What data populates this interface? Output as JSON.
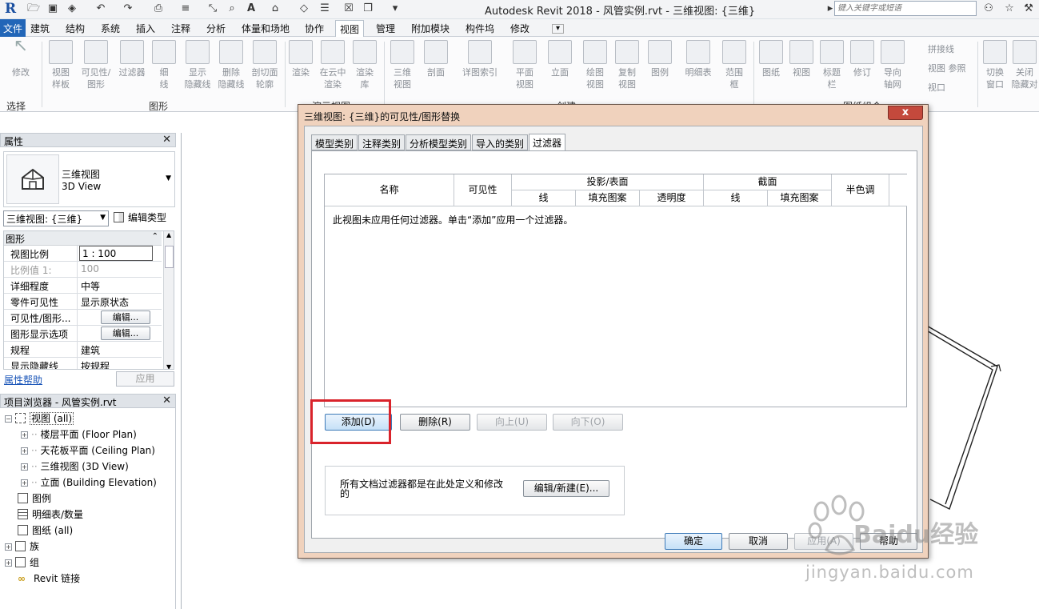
{
  "title_bar": {
    "title": "Autodesk Revit 2018 -    风管实例.rvt - 三维视图: {三维}",
    "search_placeholder": "键入关键字或短语",
    "logo": "R"
  },
  "tabs": [
    "文件",
    "建筑",
    "结构",
    "系统",
    "插入",
    "注释",
    "分析",
    "体量和场地",
    "协作",
    "视图",
    "管理",
    "附加模块",
    "构件坞",
    "修改"
  ],
  "active_tab": "视图",
  "ribbon": {
    "buttons": [
      {
        "label": "修改",
        "sub": ""
      },
      {
        "label": "视图",
        "sub": "样板"
      },
      {
        "label": "可见性/",
        "sub": "图形"
      },
      {
        "label": "过滤器",
        "sub": ""
      },
      {
        "label": "细",
        "sub": "线"
      },
      {
        "label": "显示",
        "sub": "隐藏线"
      },
      {
        "label": "删除",
        "sub": "隐藏线"
      },
      {
        "label": "剖切面",
        "sub": "轮廓"
      },
      {
        "label": "渲染",
        "sub": ""
      },
      {
        "label": "在云中",
        "sub": "渲染"
      },
      {
        "label": "渲染",
        "sub": "库"
      },
      {
        "label": "三维",
        "sub": "视图"
      },
      {
        "label": "剖面",
        "sub": ""
      },
      {
        "label": "详图索引",
        "sub": ""
      },
      {
        "label": "平面",
        "sub": "视图"
      },
      {
        "label": "立面",
        "sub": ""
      },
      {
        "label": "绘图",
        "sub": "视图"
      },
      {
        "label": "复制",
        "sub": "视图"
      },
      {
        "label": "图例",
        "sub": ""
      },
      {
        "label": "明细表",
        "sub": ""
      },
      {
        "label": "范围",
        "sub": "框"
      },
      {
        "label": "图纸",
        "sub": ""
      },
      {
        "label": "视图",
        "sub": ""
      },
      {
        "label": "标题",
        "sub": "栏"
      },
      {
        "label": "修订",
        "sub": ""
      },
      {
        "label": "导向",
        "sub": "轴网"
      },
      {
        "label": "切换",
        "sub": "窗口"
      },
      {
        "label": "关闭",
        "sub": "隐藏对"
      }
    ],
    "small_buttons": [
      "拼接线",
      "视图 参照",
      "视口"
    ],
    "panels": {
      "select": "选择",
      "graphics": "图形",
      "presentation": "演示视图",
      "create": "创建",
      "sheet": "图纸组合"
    }
  },
  "properties": {
    "header": "属性",
    "type_name": "三维视图",
    "type_name_en": "3D View",
    "view_dropdown": "三维视图: {三维}",
    "edit_type": "编辑类型",
    "section": "图形",
    "rows": [
      {
        "key": "视图比例",
        "value": "1 : 100",
        "kind": "input"
      },
      {
        "key": "比例值 1:",
        "value": "100",
        "kind": "disabled"
      },
      {
        "key": "详细程度",
        "value": "中等",
        "kind": "text"
      },
      {
        "key": "零件可见性",
        "value": "显示原状态",
        "kind": "text"
      },
      {
        "key": "可见性/图形...",
        "value": "编辑...",
        "kind": "button"
      },
      {
        "key": "图形显示选项",
        "value": "编辑...",
        "kind": "button"
      },
      {
        "key": "规程",
        "value": "建筑",
        "kind": "text"
      },
      {
        "key": "显示隐藏线",
        "value": "按规程",
        "kind": "text"
      }
    ],
    "help": "属性帮助",
    "apply": "应用"
  },
  "project_browser": {
    "header": "项目浏览器 - 风管实例.rvt",
    "items": [
      {
        "label": "视图 (all)",
        "level": 0,
        "expander": "−"
      },
      {
        "label": "楼层平面 (Floor Plan)",
        "level": 1,
        "expander": "+"
      },
      {
        "label": "天花板平面 (Ceiling Plan)",
        "level": 1,
        "expander": "+"
      },
      {
        "label": "三维视图 (3D View)",
        "level": 1,
        "expander": "+"
      },
      {
        "label": "立面 (Building Elevation)",
        "level": 1,
        "expander": "+"
      },
      {
        "label": "图例",
        "level": 0,
        "expander": ""
      },
      {
        "label": "明细表/数量",
        "level": 0,
        "expander": ""
      },
      {
        "label": "图纸 (all)",
        "level": 0,
        "expander": ""
      },
      {
        "label": "族",
        "level": 0,
        "expander": "+"
      },
      {
        "label": "组",
        "level": 0,
        "expander": "+"
      },
      {
        "label": "Revit 链接",
        "level": 0,
        "expander": ""
      }
    ]
  },
  "dialog": {
    "title": "三维视图: {三维}的可见性/图形替换",
    "close": "x",
    "tabs": [
      "模型类别",
      "注释类别",
      "分析模型类别",
      "导入的类别",
      "过滤器"
    ],
    "active_tab": "过滤器",
    "columns": {
      "name": "名称",
      "visibility": "可见性",
      "projection": "投影/表面",
      "projection_sub": [
        "线",
        "填充图案",
        "透明度"
      ],
      "cut": "截面",
      "cut_sub": [
        "线",
        "填充图案"
      ],
      "halftone": "半色调"
    },
    "empty_message": "此视图未应用任何过滤器。单击“添加”应用一个过滤器。",
    "buttons": {
      "add": "添加(D)",
      "remove": "删除(R)",
      "up": "向上(U)",
      "down": "向下(O)",
      "edit_new": "编辑/新建(E)..."
    },
    "group_text": "所有文档过滤器都是在此处定义和修改的",
    "footer": {
      "ok": "确定",
      "cancel": "取消",
      "apply": "应用(A)",
      "help": "帮助"
    }
  },
  "watermark": {
    "text": "Baidu经验",
    "url": "jingyan.baidu.com"
  },
  "colors": {
    "accent": "#2266b8",
    "highlight": "#d9232b",
    "dialog_frame": "#f0d2bd"
  }
}
